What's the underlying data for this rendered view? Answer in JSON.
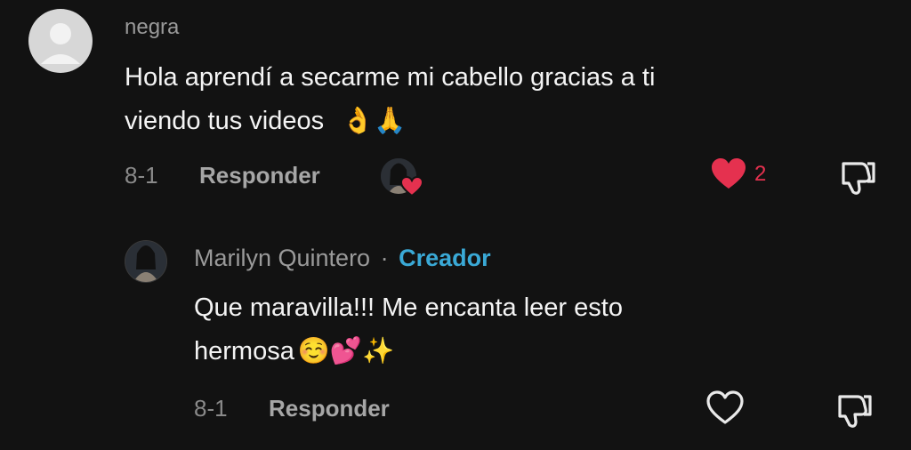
{
  "comment": {
    "username": "negra",
    "text_line1": "Hola aprendí a secarme mi cabello gracias a ti",
    "text_line2": "viendo tus videos",
    "emojis": "👌🙏",
    "date": "8-1",
    "reply_label": "Responder",
    "like_count": "2",
    "liked": true,
    "accent_color": "#e5314f"
  },
  "reply": {
    "username": "Marilyn Quintero",
    "separator": "·",
    "creator_label": "Creador",
    "text_line1": "Que maravilla!!! Me encanta leer esto",
    "text_line2": "hermosa",
    "emojis": "☺️💕✨",
    "date": "8-1",
    "reply_label": "Responder",
    "creator_color": "#3aa9d6"
  }
}
